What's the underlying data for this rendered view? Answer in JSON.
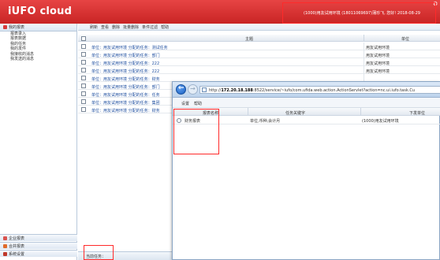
{
  "app": {
    "logo": "iUFO cloud",
    "user_info": "(1000)用友试用环境 (18011069697)蒲珍飞, 您好! 2018-08-29",
    "gear_icon": "gear-icon"
  },
  "sidebar": {
    "header": "我的报表",
    "items": [
      {
        "label": "报表录入"
      },
      {
        "label": "报表数据"
      },
      {
        "label": "我的任务"
      },
      {
        "label": "我的发件"
      },
      {
        "label": "我接收的消息"
      },
      {
        "label": "我发送的消息"
      }
    ],
    "bottom": [
      {
        "label": "企业报表"
      },
      {
        "label": "合并报表"
      },
      {
        "label": "系统设置"
      }
    ]
  },
  "toolbar": {
    "items": [
      "刷新",
      "查看",
      "删除",
      "批量删除",
      "条件过滤",
      "帮助"
    ]
  },
  "table": {
    "header_subject": "主题",
    "header_unit": "单位",
    "rows": [
      {
        "subject": "单位：用友试用环境 分配的任务：测试任务",
        "unit": "用友试用环境"
      },
      {
        "subject": "单位：用友试用环境 分配的任务：部门",
        "unit": "用友试用环境"
      },
      {
        "subject": "单位：用友试用环境 分配的任务：222",
        "unit": "用友试用环境"
      },
      {
        "subject": "单位：用友试用环境 分配的任务：222",
        "unit": "用友试用环境"
      },
      {
        "subject": "单位：用友试用环境 分配的任务：财务",
        "unit": ""
      },
      {
        "subject": "单位：用友试用环境 分配的任务：部门",
        "unit": ""
      },
      {
        "subject": "单位：用友试用环境 分配的任务：任务",
        "unit": ""
      },
      {
        "subject": "单位：用友试用环境 分配的任务：集团",
        "unit": ""
      },
      {
        "subject": "单位：用友试用环境 分配的任务：财务",
        "unit": ""
      }
    ]
  },
  "status": {
    "label": "当前任务："
  },
  "popup": {
    "url_host": "172.20.18.188",
    "url_prefix": "http://",
    "url_rest": ":8522/service/~iufo/com.ufida.web.action.ActionServlet?action=nc.ui.iufo.task.Cu",
    "menu": [
      "设置",
      "帮助"
    ],
    "headers": [
      "报表名称",
      "任务关键字",
      "下发单位"
    ],
    "rows": [
      {
        "name": "财务报表",
        "keyword": "单位,币种,会计月",
        "unit": "(1000)用友试用环境"
      }
    ]
  }
}
